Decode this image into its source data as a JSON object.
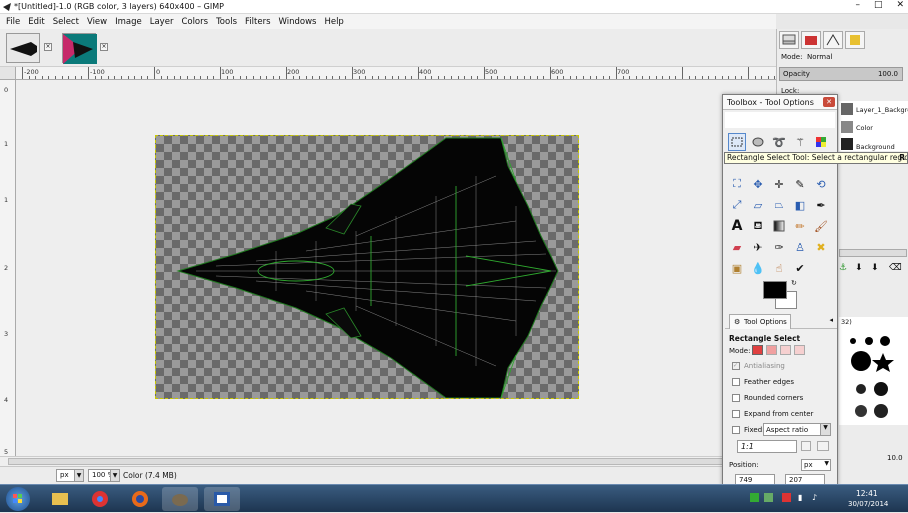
{
  "window": {
    "title": "*[Untitled]-1.0 (RGB color, 3 layers) 640x400 – GIMP",
    "min": "–",
    "max": "□",
    "close": "✕"
  },
  "menu": [
    "File",
    "Edit",
    "Select",
    "View",
    "Image",
    "Layer",
    "Colors",
    "Tools",
    "Filters",
    "Windows",
    "Help"
  ],
  "rulers": {
    "h": [
      "-200",
      "-100",
      "0",
      "100",
      "200",
      "300",
      "400",
      "500",
      "600",
      "700"
    ],
    "v": [
      "0",
      "1",
      "1",
      "2",
      "3",
      "4",
      "5"
    ]
  },
  "status": {
    "unit": "px",
    "zoom": "100 %",
    "info": "Color (7.4 MB)"
  },
  "layers": {
    "mode_label": "Mode:",
    "mode_value": "Normal",
    "opacity_label": "Opacity",
    "opacity_value": "100.0",
    "lock_label": "Lock:",
    "items": [
      "Layer_1_Backgro",
      "Color",
      "Background"
    ]
  },
  "brushes": {
    "size_value": "10.0",
    "name_suffix": "32)"
  },
  "toolbox": {
    "title": "Toolbox - Tool Options",
    "close": "✕",
    "tooltip": "Rectangle Select Tool: Select a rectangular region",
    "tooltip_suffix": "R",
    "options_tab": "Tool Options",
    "tool_name": "Rectangle Select",
    "mode_label": "Mode:",
    "antialiasing": "Antialiasing",
    "feather": "Feather edges",
    "rounded": "Rounded corners",
    "expand": "Expand from center",
    "fixed": "Fixed:",
    "fixed_value": "Aspect ratio",
    "ratio": "1:1",
    "position_label": "Position:",
    "position_unit": "px",
    "pos_x": "749",
    "pos_y": "207"
  },
  "taskbar": {
    "time": "12:41",
    "date": "30/07/2014"
  },
  "colors": {
    "accent": "#c94a3a",
    "tooltip_bg": "#ffffe1",
    "selection": "#c8c800"
  }
}
